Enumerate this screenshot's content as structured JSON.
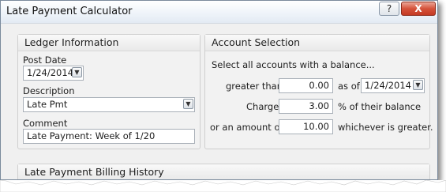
{
  "window": {
    "title": "Late Payment Calculator"
  },
  "titlebar": {
    "help_label": "?",
    "close_label": "X"
  },
  "ledger": {
    "header": "Ledger Information",
    "post_date_label": "Post Date",
    "post_date_value": "1/24/2014",
    "description_label": "Description",
    "description_value": "Late Pmt",
    "comment_label": "Comment",
    "comment_value": "Late Payment: Week of 1/20"
  },
  "account": {
    "header": "Account Selection",
    "instruction": "Select all accounts with a balance...",
    "greater_than_label": "greater than",
    "greater_than_value": "0.00",
    "as_of_label": "as of",
    "as_of_value": "1/24/2014",
    "charge_label": "Charge",
    "charge_value": "3.00",
    "charge_suffix": "% of their balance",
    "or_amount_label": "or an amount of",
    "or_amount_value": "10.00",
    "or_amount_suffix": "whichever is greater."
  },
  "history": {
    "header": "Late Payment Billing History"
  },
  "icons": {
    "dropdown": "chevron-down-icon",
    "help": "question-mark-icon",
    "close": "close-icon"
  }
}
